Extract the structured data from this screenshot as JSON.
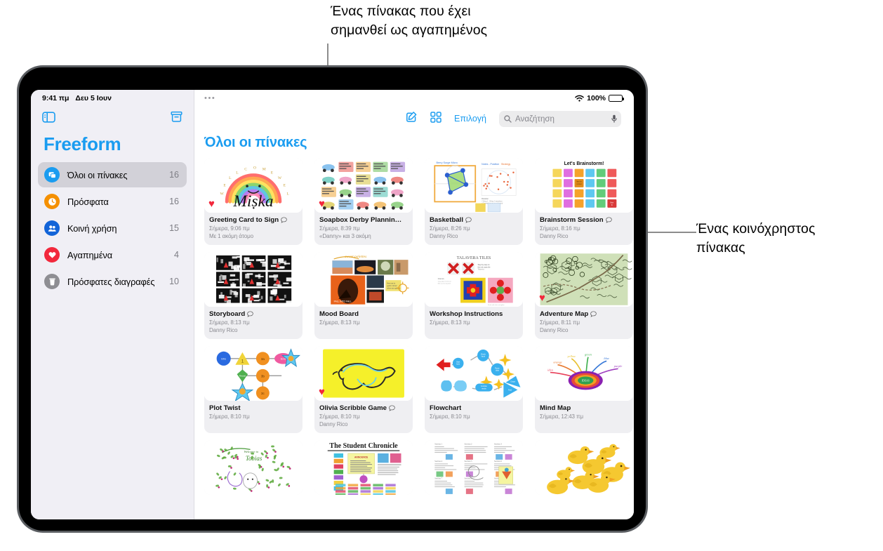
{
  "callouts": {
    "top": "Ένας πίνακας που έχει\nσημανθεί ως αγαπημένος",
    "right": "Ένας κοινόχρηστος\nπίνακας"
  },
  "statusbar": {
    "time": "9:41 πμ",
    "date": "Δευ 5 Ιουν",
    "battery_percent": "100%",
    "wifi_icon": "wifi-icon",
    "battery_icon": "battery-icon",
    "more_dots": "•••"
  },
  "sidebar": {
    "app_title": "Freeform",
    "toggle_sidebar_icon": "sidebar-toggle-icon",
    "archive_icon": "archive-box-icon",
    "items": [
      {
        "label": "Όλοι οι πίνακες",
        "count": "16",
        "icon": "boards-icon",
        "color": "#1a9cf0",
        "selected": true
      },
      {
        "label": "Πρόσφατα",
        "count": "16",
        "icon": "clock-icon",
        "color": "#f59000",
        "selected": false
      },
      {
        "label": "Κοινή χρήση",
        "count": "15",
        "icon": "people-icon",
        "color": "#1264d8",
        "selected": false
      },
      {
        "label": "Αγαπημένα",
        "count": "4",
        "icon": "heart-icon",
        "color": "#f2283c",
        "selected": false
      },
      {
        "label": "Πρόσφατες διαγραφές",
        "count": "10",
        "icon": "trash-icon",
        "color": "#8e8e93",
        "selected": false
      }
    ]
  },
  "toolbar": {
    "compose_icon": "compose-new-board-icon",
    "grid_view_icon": "grid-view-icon",
    "select_label": "Επιλογή",
    "search_icon": "search-icon",
    "search_placeholder": "Αναζήτηση",
    "search_value": "",
    "mic_icon": "microphone-icon"
  },
  "main": {
    "page_title": "Όλοι οι πίνακες"
  },
  "boards": [
    {
      "title": "Greeting Card to Sign",
      "date": "Σήμερα, 9:06 πμ",
      "shared": "Με 1 ακόμη άτομο",
      "favorite": true,
      "has_bubble": true,
      "art": "greeting-card"
    },
    {
      "title": "Soapbox Derby Plannin…",
      "date": "Σήμερα, 8:39 πμ",
      "shared": "«Danny» και 3 ακόμη",
      "favorite": true,
      "has_bubble": false,
      "art": "soapbox"
    },
    {
      "title": "Basketball",
      "date": "Σήμερα, 8:26 πμ",
      "shared": "Danny Rico",
      "favorite": false,
      "has_bubble": true,
      "art": "basketball"
    },
    {
      "title": "Brainstorm Session",
      "date": "Σήμερα, 8:16 πμ",
      "shared": "Danny Rico",
      "favorite": false,
      "has_bubble": true,
      "art": "brainstorm",
      "art_label": "Let's Brainstorm!"
    },
    {
      "title": "Storyboard",
      "date": "Σήμερα, 8:13 πμ",
      "shared": "Danny Rico",
      "favorite": false,
      "has_bubble": true,
      "art": "storyboard"
    },
    {
      "title": "Mood Board",
      "date": "Σήμερα, 8:13 πμ",
      "shared": "",
      "favorite": false,
      "has_bubble": false,
      "art": "moodboard"
    },
    {
      "title": "Workshop Instructions",
      "date": "Σήμερα, 8:13 πμ",
      "shared": "",
      "favorite": false,
      "has_bubble": false,
      "art": "workshop",
      "art_label": "TALAVERA TILES"
    },
    {
      "title": "Adventure Map",
      "date": "Σήμερα, 8:11 πμ",
      "shared": "Danny Rico",
      "favorite": true,
      "has_bubble": true,
      "art": "adventuremap"
    },
    {
      "title": "Plot Twist",
      "date": "Σήμερα, 8:10 πμ",
      "shared": "",
      "favorite": false,
      "has_bubble": false,
      "art": "plottwist"
    },
    {
      "title": "Olivia Scribble Game",
      "date": "Σήμερα, 8:10 πμ",
      "shared": "Danny Rico",
      "favorite": true,
      "has_bubble": true,
      "art": "scribble"
    },
    {
      "title": "Flowchart",
      "date": "Σήμερα, 8:10 πμ",
      "shared": "",
      "favorite": false,
      "has_bubble": false,
      "art": "flowchart"
    },
    {
      "title": "Mind Map",
      "date": "Σήμερα, 12:43 πμ",
      "shared": "",
      "favorite": false,
      "has_bubble": false,
      "art": "mindmap"
    },
    {
      "title": "",
      "date": "",
      "shared": "",
      "favorite": false,
      "has_bubble": false,
      "art": "garden"
    },
    {
      "title": "",
      "date": "",
      "shared": "",
      "favorite": false,
      "has_bubble": false,
      "art": "chronicle",
      "art_label": "The Student Chronicle"
    },
    {
      "title": "",
      "date": "",
      "shared": "",
      "favorite": false,
      "has_bubble": false,
      "art": "notes"
    },
    {
      "title": "",
      "date": "",
      "shared": "",
      "favorite": false,
      "has_bubble": false,
      "art": "ducks"
    }
  ]
}
